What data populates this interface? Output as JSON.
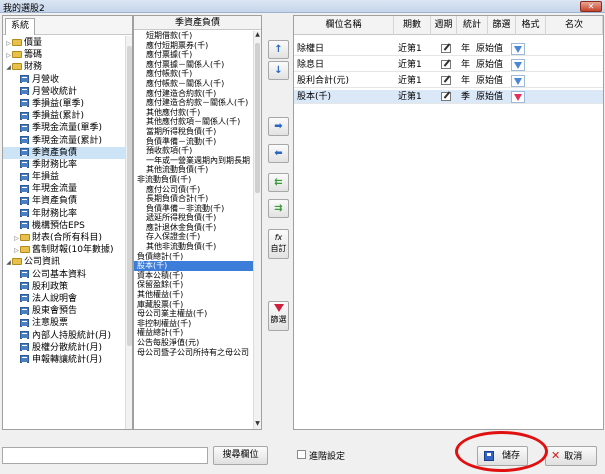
{
  "window": {
    "title": "我的選股2",
    "close_label": "✕"
  },
  "left_panel": {
    "tab": "系統",
    "items": [
      {
        "label": "價量",
        "type": "folder",
        "level": 0,
        "expanded": false
      },
      {
        "label": "籌碼",
        "type": "folder",
        "level": 0,
        "expanded": false
      },
      {
        "label": "財務",
        "type": "folder",
        "level": 0,
        "expanded": true
      },
      {
        "label": "月營收",
        "type": "table",
        "level": 1
      },
      {
        "label": "月營收統計",
        "type": "table",
        "level": 1
      },
      {
        "label": "季損益(單季)",
        "type": "table",
        "level": 1
      },
      {
        "label": "季損益(累計)",
        "type": "table",
        "level": 1
      },
      {
        "label": "季現金流量(單季)",
        "type": "table",
        "level": 1
      },
      {
        "label": "季現金流量(累計)",
        "type": "table",
        "level": 1
      },
      {
        "label": "季資產負債",
        "type": "table",
        "level": 1,
        "selected": true
      },
      {
        "label": "季財務比率",
        "type": "table",
        "level": 1
      },
      {
        "label": "年損益",
        "type": "table",
        "level": 1
      },
      {
        "label": "年現金流量",
        "type": "table",
        "level": 1
      },
      {
        "label": "年資產負債",
        "type": "table",
        "level": 1
      },
      {
        "label": "年財務比率",
        "type": "table",
        "level": 1
      },
      {
        "label": "機構預估EPS",
        "type": "table",
        "level": 1
      },
      {
        "label": "財表(合所有科目)",
        "type": "folder",
        "level": 1,
        "expanded": false
      },
      {
        "label": "舊制財報(10年數據)",
        "type": "folder",
        "level": 1,
        "expanded": false
      },
      {
        "label": "公司資訊",
        "type": "folder",
        "level": 0,
        "expanded": true
      },
      {
        "label": "公司基本資料",
        "type": "table",
        "level": 1
      },
      {
        "label": "股利政策",
        "type": "table",
        "level": 1
      },
      {
        "label": "法人說明會",
        "type": "table",
        "level": 1
      },
      {
        "label": "股東會預告",
        "type": "table",
        "level": 1
      },
      {
        "label": "注意股票",
        "type": "table",
        "level": 1
      },
      {
        "label": "內部人持股統計(月)",
        "type": "table",
        "level": 1
      },
      {
        "label": "股權分散統計(月)",
        "type": "table",
        "level": 1
      },
      {
        "label": "申報轉讓統計(月)",
        "type": "table",
        "level": 1
      }
    ]
  },
  "field_panel": {
    "header": "季資產負債",
    "items": [
      {
        "label": "短期借款(千)",
        "indent": 1
      },
      {
        "label": "應付短期票券(千)",
        "indent": 1
      },
      {
        "label": "應付票據(千)",
        "indent": 1
      },
      {
        "label": "應付票據－關係人(千)",
        "indent": 1
      },
      {
        "label": "應付帳款(千)",
        "indent": 1
      },
      {
        "label": "應付帳款－關係人(千)",
        "indent": 1
      },
      {
        "label": "應付建造合約款(千)",
        "indent": 1
      },
      {
        "label": "應付建造合約款－關係人(千)",
        "indent": 1
      },
      {
        "label": "其他應付款(千)",
        "indent": 1
      },
      {
        "label": "其他應付款項－關係人(千)",
        "indent": 1
      },
      {
        "label": "當期所得稅負債(千)",
        "indent": 1
      },
      {
        "label": "負債準備－流動(千)",
        "indent": 1
      },
      {
        "label": "預收款項(千)",
        "indent": 1
      },
      {
        "label": "一年或一營業週期內到期長期",
        "indent": 1
      },
      {
        "label": "其他流動負債(千)",
        "indent": 1
      },
      {
        "label": "非流動負債(千)",
        "indent": 0
      },
      {
        "label": "應付公司債(千)",
        "indent": 1
      },
      {
        "label": "長期負債合計(千)",
        "indent": 1
      },
      {
        "label": "負債準備－非流動(千)",
        "indent": 1
      },
      {
        "label": "遞延所得稅負債(千)",
        "indent": 1
      },
      {
        "label": "應計退休金負債(千)",
        "indent": 1
      },
      {
        "label": "存入保證金(千)",
        "indent": 1
      },
      {
        "label": "其他非流動負債(千)",
        "indent": 1
      },
      {
        "label": "負債總計(千)",
        "indent": 0
      },
      {
        "label": "股本(千)",
        "indent": 0,
        "selected": true
      },
      {
        "label": "資本公積(千)",
        "indent": 0
      },
      {
        "label": "保留盈餘(千)",
        "indent": 0
      },
      {
        "label": "其他權益(千)",
        "indent": 0
      },
      {
        "label": "庫藏股票(千)",
        "indent": 0
      },
      {
        "label": "母公司業主權益(千)",
        "indent": 0
      },
      {
        "label": "非控制權益(千)",
        "indent": 0
      },
      {
        "label": "權益總計(千)",
        "indent": 0
      },
      {
        "label": "公告每股淨值(元)",
        "indent": 0
      },
      {
        "label": "母公司暨子公司所持有之母公司",
        "indent": 0
      }
    ]
  },
  "buttons": {
    "move_up": "↑",
    "move_down": "↓",
    "add": "➡",
    "remove": "⬅",
    "remove_all": "⇇",
    "add_all": "⇉",
    "formula_icon": "fx",
    "formula": "自訂",
    "filter": "篩選"
  },
  "grid": {
    "columns": [
      "欄位名稱",
      "期數",
      "週期",
      "統計",
      "篩選",
      "格式",
      "名次"
    ],
    "rows": [
      {
        "name": "除權日",
        "period": "近第1",
        "cycle": "年",
        "stat": "原始值",
        "filter_active": false,
        "selected": false
      },
      {
        "name": "除息日",
        "period": "近第1",
        "cycle": "年",
        "stat": "原始值",
        "filter_active": false,
        "selected": false
      },
      {
        "name": "股利合計(元)",
        "period": "近第1",
        "cycle": "年",
        "stat": "原始值",
        "filter_active": false,
        "selected": false
      },
      {
        "name": "股本(千)",
        "period": "近第1",
        "cycle": "季",
        "stat": "原始值",
        "filter_active": true,
        "selected": true
      }
    ]
  },
  "bottom": {
    "search_value": "",
    "locate_button": "搜尋欄位",
    "advanced_label": "進階設定",
    "save_button": "儲存",
    "cancel_button": "取消"
  },
  "colors": {
    "selection": "#3b7dd8",
    "highlight_ring": "#e01010",
    "funnel": "#4a86d6",
    "funnel_active": "#e0305a"
  }
}
